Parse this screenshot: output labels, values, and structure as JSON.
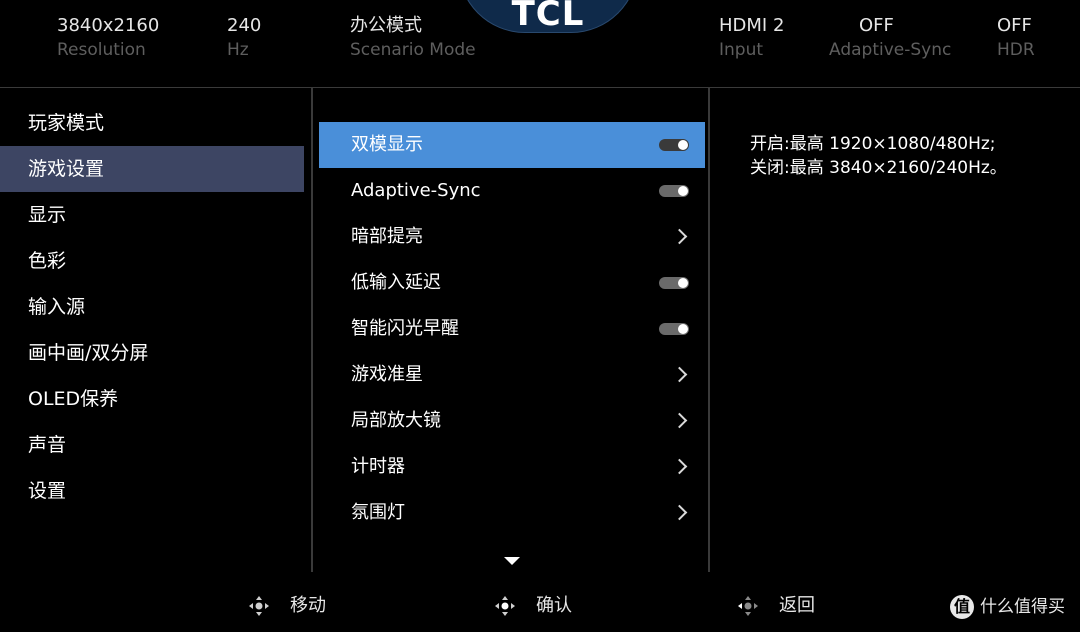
{
  "info_bar": {
    "items": [
      {
        "value": "3840x2160",
        "label": "Resolution"
      },
      {
        "value": "240",
        "label": "Hz"
      },
      {
        "value": "办公模式",
        "label": "Scenario Mode"
      },
      {
        "value": "HDMI 2",
        "label": "Input"
      },
      {
        "value": "OFF",
        "label": "Adaptive-Sync"
      },
      {
        "value": "OFF",
        "label": "HDR"
      }
    ],
    "brand": "TCL"
  },
  "left_menu": {
    "items": [
      {
        "label": "玩家模式"
      },
      {
        "label": "游戏设置"
      },
      {
        "label": "显示"
      },
      {
        "label": "色彩"
      },
      {
        "label": "输入源"
      },
      {
        "label": "画中画/双分屏"
      },
      {
        "label": "OLED保养"
      },
      {
        "label": "声音"
      },
      {
        "label": "设置"
      }
    ],
    "active_index": 1
  },
  "options": {
    "items": [
      {
        "label": "双模显示",
        "control": "toggle"
      },
      {
        "label": "Adaptive-Sync",
        "control": "toggle"
      },
      {
        "label": "暗部提亮",
        "control": "submenu"
      },
      {
        "label": "低输入延迟",
        "control": "toggle"
      },
      {
        "label": "智能闪光早醒",
        "control": "toggle"
      },
      {
        "label": "游戏准星",
        "control": "submenu"
      },
      {
        "label": "局部放大镜",
        "control": "submenu"
      },
      {
        "label": "计时器",
        "control": "submenu"
      },
      {
        "label": "氛围灯",
        "control": "submenu"
      }
    ],
    "selected_index": 0
  },
  "description": {
    "line1": "开启:最高 1920×1080/480Hz;",
    "line2": "关闭:最高 3840×2160/240Hz。"
  },
  "hints": {
    "move": "移动",
    "confirm": "确认",
    "back": "返回"
  },
  "watermark": {
    "symbol": "值",
    "text": "什么值得买"
  },
  "colors": {
    "background": "#000000",
    "active_category": "#3d4563",
    "selected_option": "#4a8fd9",
    "label_gray": "#5e5e5e"
  },
  "icons": {
    "toggle": "toggle-switch-icon",
    "submenu": "chevron-right-icon",
    "scroll": "triangle-down-icon",
    "dpad": "dpad-icon"
  }
}
